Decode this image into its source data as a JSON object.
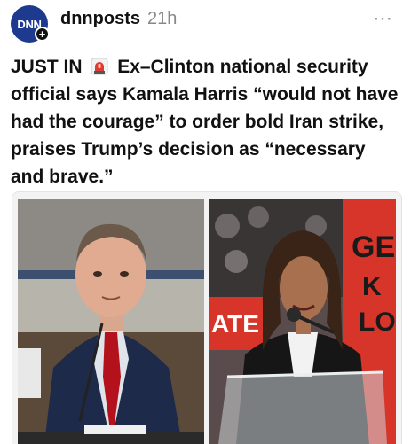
{
  "post": {
    "username": "dnnposts",
    "timestamp": "21h",
    "avatar_text": "DNN",
    "more_icon": "⋯",
    "text_before_icon": "JUST IN ",
    "text_after_icon": " Ex–Clinton national security official says Kamala Harris “would not have had the courage” to order bold Iran strike, praises Trump’s decision as “necessary and brave.”",
    "icon": "siren-icon"
  },
  "media": {
    "right_sign_text": "GEC K LO",
    "right_sign_lower": "ATE"
  },
  "colors": {
    "avatar": "#1d3a8f",
    "timestamp": "#888888",
    "sign_red": "#d7342a"
  }
}
